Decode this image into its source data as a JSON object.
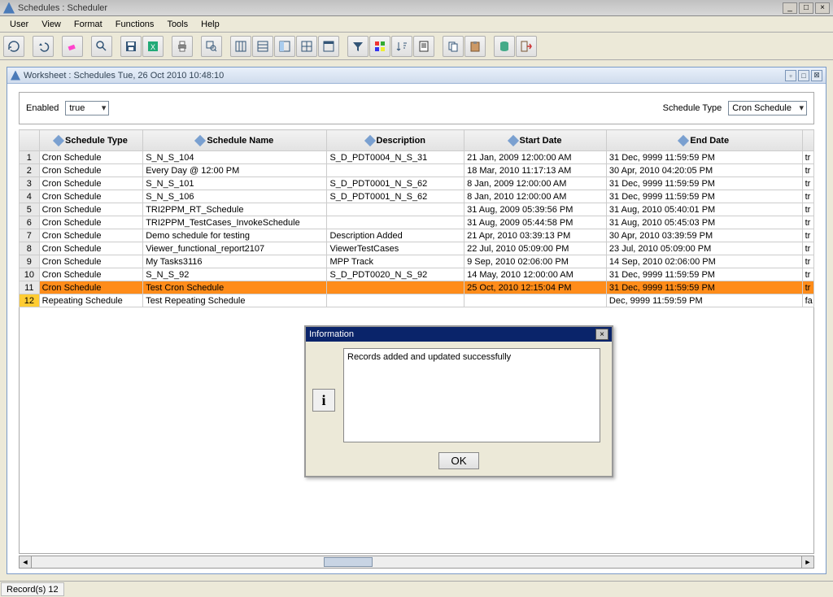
{
  "window": {
    "title": "Schedules : Scheduler"
  },
  "menu": {
    "user": "User",
    "view": "View",
    "format": "Format",
    "functions": "Functions",
    "tools": "Tools",
    "help": "Help"
  },
  "inner": {
    "title": "Worksheet : Schedules Tue, 26 Oct 2010 10:48:10"
  },
  "filter": {
    "enabled_label": "Enabled",
    "enabled_value": "true",
    "type_label": "Schedule Type",
    "type_value": "Cron Schedule"
  },
  "columns": {
    "schedule_type": "Schedule Type",
    "schedule_name": "Schedule Name",
    "description": "Description",
    "start_date": "Start Date",
    "end_date": "End Date"
  },
  "rows": [
    {
      "n": "1",
      "type": "Cron Schedule",
      "name": "S_N_S_104",
      "desc": "S_D_PDT0004_N_S_31",
      "start": "21 Jan, 2009 12:00:00 AM",
      "end": "31 Dec, 9999 11:59:59 PM",
      "x": "tr"
    },
    {
      "n": "2",
      "type": "Cron Schedule",
      "name": "Every Day @ 12:00 PM",
      "desc": "",
      "start": "18 Mar, 2010 11:17:13 AM",
      "end": "30 Apr, 2010 04:20:05 PM",
      "x": "tr"
    },
    {
      "n": "3",
      "type": "Cron Schedule",
      "name": "S_N_S_101",
      "desc": "S_D_PDT0001_N_S_62",
      "start": "8 Jan, 2009 12:00:00 AM",
      "end": "31 Dec, 9999 11:59:59 PM",
      "x": "tr"
    },
    {
      "n": "4",
      "type": "Cron Schedule",
      "name": "S_N_S_106",
      "desc": "S_D_PDT0001_N_S_62",
      "start": "8 Jan, 2010 12:00:00 AM",
      "end": "31 Dec, 9999 11:59:59 PM",
      "x": "tr"
    },
    {
      "n": "5",
      "type": "Cron Schedule",
      "name": "TRI2PPM_RT_Schedule",
      "desc": "",
      "start": "31 Aug, 2009 05:39:56 PM",
      "end": "31 Aug, 2010 05:40:01 PM",
      "x": "tr"
    },
    {
      "n": "6",
      "type": "Cron Schedule",
      "name": "TRI2PPM_TestCases_InvokeSchedule",
      "desc": "",
      "start": "31 Aug, 2009 05:44:58 PM",
      "end": "31 Aug, 2010 05:45:03 PM",
      "x": "tr"
    },
    {
      "n": "7",
      "type": "Cron Schedule",
      "name": "Demo schedule for testing",
      "desc": "Description Added",
      "start": "21 Apr, 2010 03:39:13 PM",
      "end": "30 Apr, 2010 03:39:59 PM",
      "x": "tr"
    },
    {
      "n": "8",
      "type": "Cron Schedule",
      "name": "Viewer_functional_report2107",
      "desc": "ViewerTestCases",
      "start": "22 Jul, 2010 05:09:00 PM",
      "end": "23 Jul, 2010 05:09:00 PM",
      "x": "tr"
    },
    {
      "n": "9",
      "type": "Cron Schedule",
      "name": "My Tasks3116",
      "desc": "MPP Track",
      "start": "9 Sep, 2010 02:06:00 PM",
      "end": "14 Sep, 2010 02:06:00 PM",
      "x": "tr"
    },
    {
      "n": "10",
      "type": "Cron Schedule",
      "name": "S_N_S_92",
      "desc": "S_D_PDT0020_N_S_92",
      "start": "14 May, 2010 12:00:00 AM",
      "end": "31 Dec, 9999 11:59:59 PM",
      "x": "tr"
    },
    {
      "n": "11",
      "type": "Cron Schedule",
      "name": "Test Cron Schedule",
      "desc": "",
      "start": "25 Oct, 2010 12:15:04 PM",
      "end": "31 Dec, 9999 11:59:59 PM",
      "x": "tr"
    },
    {
      "n": "12",
      "type": "Repeating Schedule",
      "name": "Test Repeating Schedule",
      "desc": "",
      "start": "",
      "end": "Dec, 9999 11:59:59 PM",
      "x": "fa"
    }
  ],
  "dialog": {
    "title": "Information",
    "message": "Records added and updated successfully",
    "ok": "OK",
    "icon_letter": "i"
  },
  "status": {
    "records": "Record(s) 12"
  }
}
